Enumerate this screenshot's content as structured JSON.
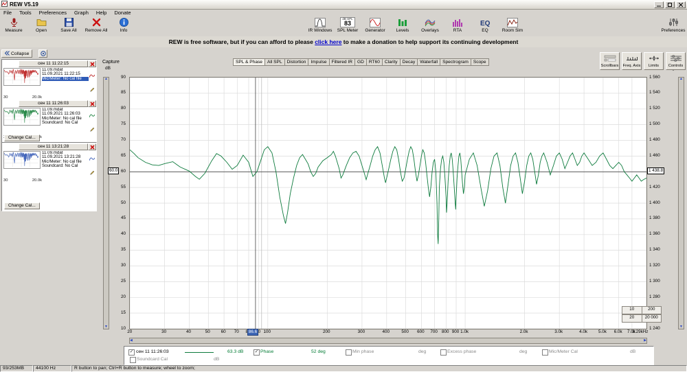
{
  "window": {
    "title": "REW V5.19"
  },
  "menu": {
    "items": [
      "File",
      "Tools",
      "Preferences",
      "Graph",
      "Help",
      "Donate"
    ]
  },
  "toolbar": {
    "left": [
      {
        "id": "measure",
        "label": "Measure"
      },
      {
        "id": "open",
        "label": "Open"
      },
      {
        "id": "save-all",
        "label": "Save All"
      },
      {
        "id": "remove-all",
        "label": "Remove All"
      },
      {
        "id": "info",
        "label": "Info"
      }
    ],
    "center": [
      {
        "id": "ir-windows",
        "label": "IR Windows"
      },
      {
        "id": "spl-meter",
        "label": "SPL Meter"
      },
      {
        "id": "generator",
        "label": "Generator"
      },
      {
        "id": "levels",
        "label": "Levels"
      },
      {
        "id": "overlays",
        "label": "Overlays"
      },
      {
        "id": "rta",
        "label": "RTA"
      },
      {
        "id": "eq",
        "label": "EQ"
      },
      {
        "id": "room-sim",
        "label": "Room Sim"
      }
    ],
    "right": [
      {
        "id": "preferences",
        "label": "Preferences"
      }
    ],
    "spl_value": "83",
    "spl_unit": "dB SPL"
  },
  "banner": {
    "pre": "REW is free software, but if you can afford to please ",
    "link": "click here",
    "post": " to make a donation to help support its continuing development"
  },
  "sidebar": {
    "collapse_label": "Collapse",
    "panels": [
      {
        "change_cal": "Change Cal...",
        "items": [
          {
            "title": "сен 11 11:22:15",
            "file": "11.09.mdat",
            "datetime": "11.09.2021 11:22:15",
            "mic_cal": "Mic/Meter: No cal file",
            "soundcard_cal": null,
            "color": "#c03030",
            "x_min": "30",
            "x_max": "20.0k",
            "mic_selected": true
          },
          {
            "title": "сен 11 11:26:03",
            "file": "11.09.mdat",
            "datetime": "11.09.2021 11:26:03",
            "mic_cal": "Mic/Meter: No cal file",
            "soundcard_cal": "Soundcard: No Cal",
            "color": "#2a8a4a",
            "x_min": "30",
            "x_max": "20.0k",
            "mic_selected": false
          }
        ]
      },
      {
        "change_cal": "Change Cal...",
        "items": [
          {
            "title": "сен 11 13:21:28",
            "file": "11.09.mdat",
            "datetime": "11.09.2021 13:21:28",
            "mic_cal": "Mic/Meter: No cal file",
            "soundcard_cal": "Soundcard: No Cal",
            "color": "#4466bb",
            "x_min": "30",
            "x_max": "20.0k",
            "mic_selected": false
          }
        ]
      }
    ]
  },
  "graph": {
    "capture_label": "Capture",
    "unit_left": "dB",
    "unit_right": "deg",
    "tabs": [
      "SPL & Phase",
      "All SPL",
      "Distortion",
      "Impulse",
      "Filtered IR",
      "GD",
      "RT60",
      "Clarity",
      "Decay",
      "Waterfall",
      "Spectrogram",
      "Scope"
    ],
    "selected_tab": "SPL & Phase",
    "top_buttons": [
      "Scrollbars",
      "Freq. Axis",
      "Limits",
      "Controls"
    ],
    "zoom_presets": [
      {
        "from": "10",
        "to": "200"
      },
      {
        "from": "20",
        "to": "20 000"
      }
    ]
  },
  "chart_data": {
    "type": "line",
    "title": "SPL & Phase",
    "x_scale": "log",
    "x_unit": "Hz",
    "xlim": [
      20,
      8290
    ],
    "ylim_left": [
      10,
      90
    ],
    "ylabel_left": "dB",
    "ylim_right": [
      1240,
      1560
    ],
    "ylabel_right": "deg",
    "grid": true,
    "x_ticks": [
      {
        "f": 20,
        "label": "20"
      },
      {
        "f": 30,
        "label": "30"
      },
      {
        "f": 40,
        "label": "40"
      },
      {
        "f": 50,
        "label": "50"
      },
      {
        "f": 60,
        "label": "60"
      },
      {
        "f": 70,
        "label": "70"
      },
      {
        "f": 80,
        "label": "80"
      },
      {
        "f": 90,
        "label": "90"
      },
      {
        "f": 100,
        "label": "100"
      },
      {
        "f": 200,
        "label": "200"
      },
      {
        "f": 300,
        "label": "300"
      },
      {
        "f": 400,
        "label": "400"
      },
      {
        "f": 500,
        "label": "500"
      },
      {
        "f": 600,
        "label": "600"
      },
      {
        "f": 700,
        "label": "700"
      },
      {
        "f": 800,
        "label": "800"
      },
      {
        "f": 900,
        "label": "900"
      },
      {
        "f": 1000,
        "label": "1.0k"
      },
      {
        "f": 2000,
        "label": "2.0k"
      },
      {
        "f": 3000,
        "label": "3.0k"
      },
      {
        "f": 4000,
        "label": "4.0k"
      },
      {
        "f": 5000,
        "label": "5.0k"
      },
      {
        "f": 6000,
        "label": "6.0k"
      },
      {
        "f": 7000,
        "label": "7.0k"
      },
      {
        "f": 8290,
        "label": "8.29kHz"
      }
    ],
    "y_ticks_left": [
      "90",
      "85",
      "80",
      "75",
      "70",
      "65",
      "60",
      "55",
      "50",
      "45",
      "40",
      "35",
      "30",
      "25",
      "20",
      "15",
      "10"
    ],
    "y_ticks_right": [
      "1 560",
      "1 540",
      "1 520",
      "1 500",
      "1 480",
      "1 460",
      "1 440",
      "1 420",
      "1 400",
      "1 380",
      "1 360",
      "1 340",
      "1 320",
      "1 300",
      "1 280",
      "1 260",
      "1 240"
    ],
    "cursor": {
      "freq": 86.6,
      "freq_label": "86.6",
      "db": 60.0,
      "db_label": "60.0",
      "deg_label": "1 438.8",
      "freq2": 93
    },
    "series": [
      {
        "name": "сен 11 11:26:03",
        "color": "#0c7a3c",
        "unit": "dB",
        "points": [
          [
            20,
            67
          ],
          [
            21,
            65.8
          ],
          [
            22,
            64.5
          ],
          [
            24,
            63
          ],
          [
            26,
            62.2
          ],
          [
            28,
            62
          ],
          [
            30,
            62.6
          ],
          [
            33,
            63.2
          ],
          [
            36,
            61.5
          ],
          [
            40,
            60.2
          ],
          [
            43,
            58.5
          ],
          [
            45,
            57.6
          ],
          [
            48,
            59.5
          ],
          [
            52,
            63.5
          ],
          [
            55,
            65.8
          ],
          [
            58,
            65
          ],
          [
            62,
            63
          ],
          [
            66,
            60.8
          ],
          [
            70,
            62
          ],
          [
            75,
            65.3
          ],
          [
            80,
            63
          ],
          [
            84,
            58.5
          ],
          [
            88,
            60
          ],
          [
            92,
            63.5
          ],
          [
            96,
            67
          ],
          [
            100,
            68
          ],
          [
            105,
            66
          ],
          [
            110,
            60
          ],
          [
            115,
            52
          ],
          [
            120,
            46
          ],
          [
            123,
            43.5
          ],
          [
            126,
            47
          ],
          [
            130,
            53
          ],
          [
            135,
            58
          ],
          [
            140,
            62
          ],
          [
            145,
            64.5
          ],
          [
            150,
            65.5
          ],
          [
            155,
            64
          ],
          [
            160,
            62.5
          ],
          [
            165,
            60
          ],
          [
            170,
            58.5
          ],
          [
            175,
            59.5
          ],
          [
            180,
            61.5
          ],
          [
            190,
            63.5
          ],
          [
            200,
            64.5
          ],
          [
            210,
            65.5
          ],
          [
            215,
            66.5
          ],
          [
            220,
            65
          ],
          [
            230,
            61
          ],
          [
            235,
            58
          ],
          [
            240,
            59
          ],
          [
            250,
            62
          ],
          [
            260,
            64.5
          ],
          [
            270,
            66
          ],
          [
            280,
            66.5
          ],
          [
            290,
            65
          ],
          [
            300,
            62
          ],
          [
            310,
            59
          ],
          [
            315,
            57.5
          ],
          [
            320,
            59
          ],
          [
            330,
            62
          ],
          [
            340,
            65
          ],
          [
            350,
            67
          ],
          [
            360,
            68
          ],
          [
            370,
            66
          ],
          [
            380,
            62
          ],
          [
            390,
            58
          ],
          [
            395,
            56.5
          ],
          [
            400,
            58
          ],
          [
            410,
            61
          ],
          [
            420,
            64
          ],
          [
            430,
            66.5
          ],
          [
            440,
            68
          ],
          [
            450,
            67
          ],
          [
            460,
            64
          ],
          [
            470,
            60
          ],
          [
            480,
            57
          ],
          [
            490,
            58
          ],
          [
            500,
            61
          ],
          [
            510,
            64
          ],
          [
            520,
            66.5
          ],
          [
            530,
            68
          ],
          [
            540,
            67
          ],
          [
            550,
            64
          ],
          [
            560,
            60
          ],
          [
            570,
            57
          ],
          [
            580,
            59
          ],
          [
            590,
            62
          ],
          [
            600,
            65
          ],
          [
            610,
            67
          ],
          [
            620,
            66
          ],
          [
            630,
            63
          ],
          [
            640,
            59
          ],
          [
            650,
            55
          ],
          [
            660,
            52
          ],
          [
            670,
            55
          ],
          [
            680,
            60
          ],
          [
            690,
            63
          ],
          [
            700,
            64
          ],
          [
            710,
            60
          ],
          [
            720,
            50
          ],
          [
            725,
            40
          ],
          [
            730,
            37
          ],
          [
            735,
            45
          ],
          [
            740,
            55
          ],
          [
            750,
            61
          ],
          [
            760,
            64
          ],
          [
            770,
            65
          ],
          [
            780,
            63
          ],
          [
            790,
            58
          ],
          [
            800,
            52
          ],
          [
            805,
            47
          ],
          [
            810,
            50
          ],
          [
            820,
            57
          ],
          [
            830,
            62
          ],
          [
            840,
            65
          ],
          [
            850,
            66
          ],
          [
            860,
            64
          ],
          [
            870,
            60
          ],
          [
            880,
            55
          ],
          [
            890,
            50
          ],
          [
            895,
            48
          ],
          [
            900,
            52
          ],
          [
            910,
            58
          ],
          [
            920,
            62
          ],
          [
            930,
            65
          ],
          [
            940,
            66
          ],
          [
            950,
            64
          ],
          [
            960,
            60
          ],
          [
            970,
            56
          ],
          [
            980,
            53
          ],
          [
            990,
            55
          ],
          [
            1000,
            59
          ],
          [
            1050,
            64
          ],
          [
            1100,
            66
          ],
          [
            1150,
            62
          ],
          [
            1200,
            55
          ],
          [
            1250,
            49
          ],
          [
            1300,
            54
          ],
          [
            1350,
            61
          ],
          [
            1400,
            65
          ],
          [
            1450,
            66
          ],
          [
            1500,
            62
          ],
          [
            1550,
            55
          ],
          [
            1600,
            50
          ],
          [
            1650,
            56
          ],
          [
            1700,
            62
          ],
          [
            1750,
            65
          ],
          [
            1800,
            66
          ],
          [
            1850,
            63
          ],
          [
            1900,
            58
          ],
          [
            1950,
            53
          ],
          [
            2000,
            57
          ],
          [
            2050,
            62
          ],
          [
            2100,
            65
          ],
          [
            2150,
            66
          ],
          [
            2200,
            64
          ],
          [
            2250,
            60
          ],
          [
            2300,
            56
          ],
          [
            2350,
            59
          ],
          [
            2400,
            63
          ],
          [
            2450,
            65
          ],
          [
            2500,
            66
          ],
          [
            2600,
            63
          ],
          [
            2700,
            59
          ],
          [
            2800,
            62
          ],
          [
            2900,
            65
          ],
          [
            3000,
            66
          ],
          [
            3100,
            64
          ],
          [
            3200,
            61
          ],
          [
            3300,
            63
          ],
          [
            3400,
            65
          ],
          [
            3500,
            66
          ],
          [
            3600,
            64
          ],
          [
            3700,
            62
          ],
          [
            3800,
            63
          ],
          [
            3900,
            65
          ],
          [
            4000,
            66
          ],
          [
            4200,
            64
          ],
          [
            4400,
            62
          ],
          [
            4600,
            63
          ],
          [
            4800,
            65
          ],
          [
            5000,
            66
          ],
          [
            5200,
            64
          ],
          [
            5400,
            62
          ],
          [
            5600,
            61
          ],
          [
            5800,
            62
          ],
          [
            6000,
            63
          ],
          [
            6200,
            62
          ],
          [
            6400,
            60
          ],
          [
            6600,
            59
          ],
          [
            6800,
            58
          ],
          [
            7000,
            57
          ],
          [
            7200,
            58
          ],
          [
            7400,
            59
          ],
          [
            7600,
            58
          ],
          [
            7800,
            57
          ],
          [
            8000,
            57.5
          ],
          [
            8290,
            58
          ]
        ]
      }
    ]
  },
  "legend": {
    "measurement": "сен 11 11:26:03",
    "trace_color": "#0c7a3c",
    "spl_value": "63.3 dB",
    "phase_label": "Phase",
    "phase_value": "52 deg",
    "min_phase_label": "Min phase",
    "min_phase_unit": "deg",
    "excess_phase_label": "Excess phase",
    "excess_phase_unit": "deg",
    "mic_cal_label": "Mic/Meter Cal",
    "mic_cal_unit": "dB",
    "soundcard_label": "Soundcard Cal",
    "soundcard_unit": "dB",
    "checks": {
      "measurement": true,
      "phase": true,
      "min_phase": false,
      "excess_phase": false,
      "mic_cal": false,
      "soundcard": false
    }
  },
  "statusbar": {
    "memory": "93/253MB",
    "samplerate": "44100 Hz",
    "hint": "R button to pan; Ctrl+R button to measure; wheel to zoom;"
  }
}
